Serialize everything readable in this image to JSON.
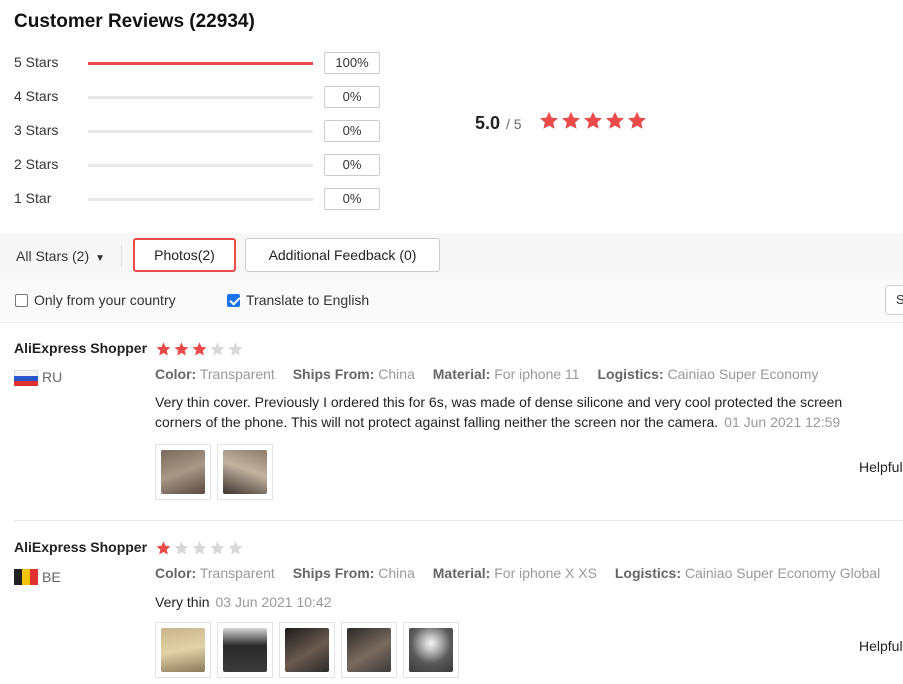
{
  "summary": {
    "title": "Customer Reviews (22934)",
    "average": "5.0",
    "max": "/ 5",
    "stars": 5,
    "distribution": [
      {
        "label": "5 Stars",
        "percent": "100%",
        "fraction": 1.0
      },
      {
        "label": "4 Stars",
        "percent": "0%",
        "fraction": 0
      },
      {
        "label": "3 Stars",
        "percent": "0%",
        "fraction": 0
      },
      {
        "label": "2 Stars",
        "percent": "0%",
        "fraction": 0
      },
      {
        "label": "1 Star",
        "percent": "0%",
        "fraction": 0
      }
    ]
  },
  "filters": {
    "all_stars": "All Stars (2)",
    "photos": "Photos(2)",
    "additional_feedback": "Additional Feedback (0)",
    "only_country": "Only from your country",
    "translate": "Translate to English",
    "sort_value": "S"
  },
  "reviews": [
    {
      "name": "AliExpress Shopper",
      "country": "RU",
      "rating": 3,
      "color_label": "Color:",
      "color": "Transparent",
      "ships_label": "Ships From:",
      "ships": "China",
      "material_label": "Material:",
      "material": "For iphone 11",
      "logistics_label": "Logistics:",
      "logistics": "Cainiao Super Economy",
      "text_line1": "Very thin cover. Previously I ordered this for 6s, was made of dense silicone and very cool protected the screen",
      "text_line2": "corners of the phone. This will not protect against falling neither the screen nor the camera.",
      "date": "01 Jun 2021 12:59",
      "helpful": "Helpful"
    },
    {
      "name": "AliExpress Shopper",
      "country": "BE",
      "rating": 1,
      "color_label": "Color:",
      "color": "Transparent",
      "ships_label": "Ships From:",
      "ships": "China",
      "material_label": "Material:",
      "material": "For iphone X XS",
      "logistics_label": "Logistics:",
      "logistics": "Cainiao Super Economy Global",
      "text_line1": "Very thin",
      "date": "03 Jun 2021 10:42",
      "helpful": "Helpful"
    }
  ],
  "colors": {
    "accent": "#e94b4b",
    "star_empty": "#d8d8d8",
    "checkbox": "#1a73e8"
  }
}
